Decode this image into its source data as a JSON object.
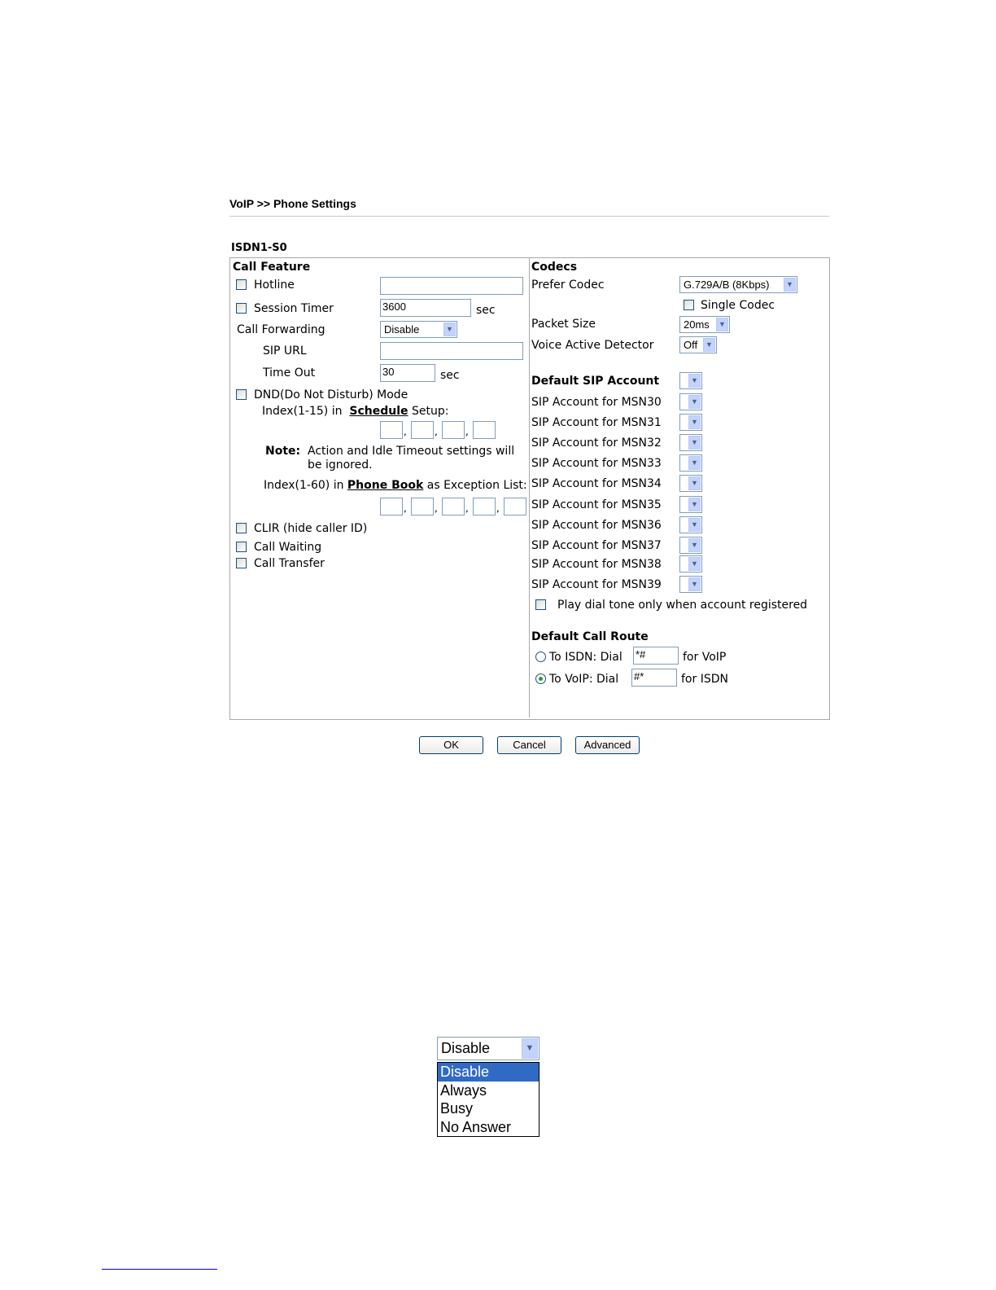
{
  "page": {
    "title": "VoIP >> Phone Settings",
    "port": "ISDN1-S0"
  },
  "call_feature": {
    "heading": "Call Feature",
    "hotline": {
      "label": "Hotline",
      "value": ""
    },
    "session_timer": {
      "label": "Session Timer",
      "value": "3600",
      "unit": "sec"
    },
    "call_forwarding": {
      "label": "Call Forwarding",
      "value": "Disable"
    },
    "sip_url": {
      "label": "SIP URL",
      "value": ""
    },
    "time_out": {
      "label": "Time Out",
      "value": "30",
      "unit": "sec"
    },
    "dnd": {
      "label": "DND(Do Not Disturb) Mode",
      "schedule_prefix": "Index(1-15) in",
      "schedule_link": "Schedule",
      "schedule_suffix": "Setup:",
      "note_label": "Note:",
      "note_line1": "Action and Idle Timeout settings will",
      "note_line2": "be ignored.",
      "phonebook_prefix": "Index(1-60) in",
      "phonebook_link": "Phone Book",
      "phonebook_suffix": "as Exception List:"
    },
    "clir": {
      "label": "CLIR (hide caller ID)"
    },
    "call_waiting": {
      "label": "Call Waiting"
    },
    "call_transfer": {
      "label": "Call Transfer"
    }
  },
  "codecs": {
    "heading": "Codecs",
    "prefer_codec": {
      "label": "Prefer Codec",
      "value": "G.729A/B (8Kbps)"
    },
    "single_codec": {
      "label": "Single Codec"
    },
    "packet_size": {
      "label": "Packet Size",
      "value": "20ms"
    },
    "vad": {
      "label": "Voice Active Detector",
      "value": "Off"
    }
  },
  "sip_accounts": {
    "default_label": "Default SIP Account",
    "rows": [
      "SIP Account for MSN30",
      "SIP Account for MSN31",
      "SIP Account for MSN32",
      "SIP Account for MSN33",
      "SIP Account for MSN34",
      "SIP Account for MSN35",
      "SIP Account for MSN36",
      "SIP Account for MSN37",
      "SIP Account for MSN38",
      "SIP Account for MSN39"
    ],
    "play_dial_tone": "Play dial tone only when account registered"
  },
  "call_route": {
    "heading": "Default Call Route",
    "to_isdn": {
      "label": "To ISDN: Dial",
      "value": "*#",
      "suffix": "for VoIP"
    },
    "to_voip": {
      "label": "To VoIP: Dial",
      "value": "#*",
      "suffix": "for ISDN"
    }
  },
  "buttons": {
    "ok": "OK",
    "cancel": "Cancel",
    "advanced": "Advanced"
  },
  "dropdown_example": {
    "selected": "Disable",
    "options": [
      "Disable",
      "Always",
      "Busy",
      "No Answer"
    ]
  }
}
